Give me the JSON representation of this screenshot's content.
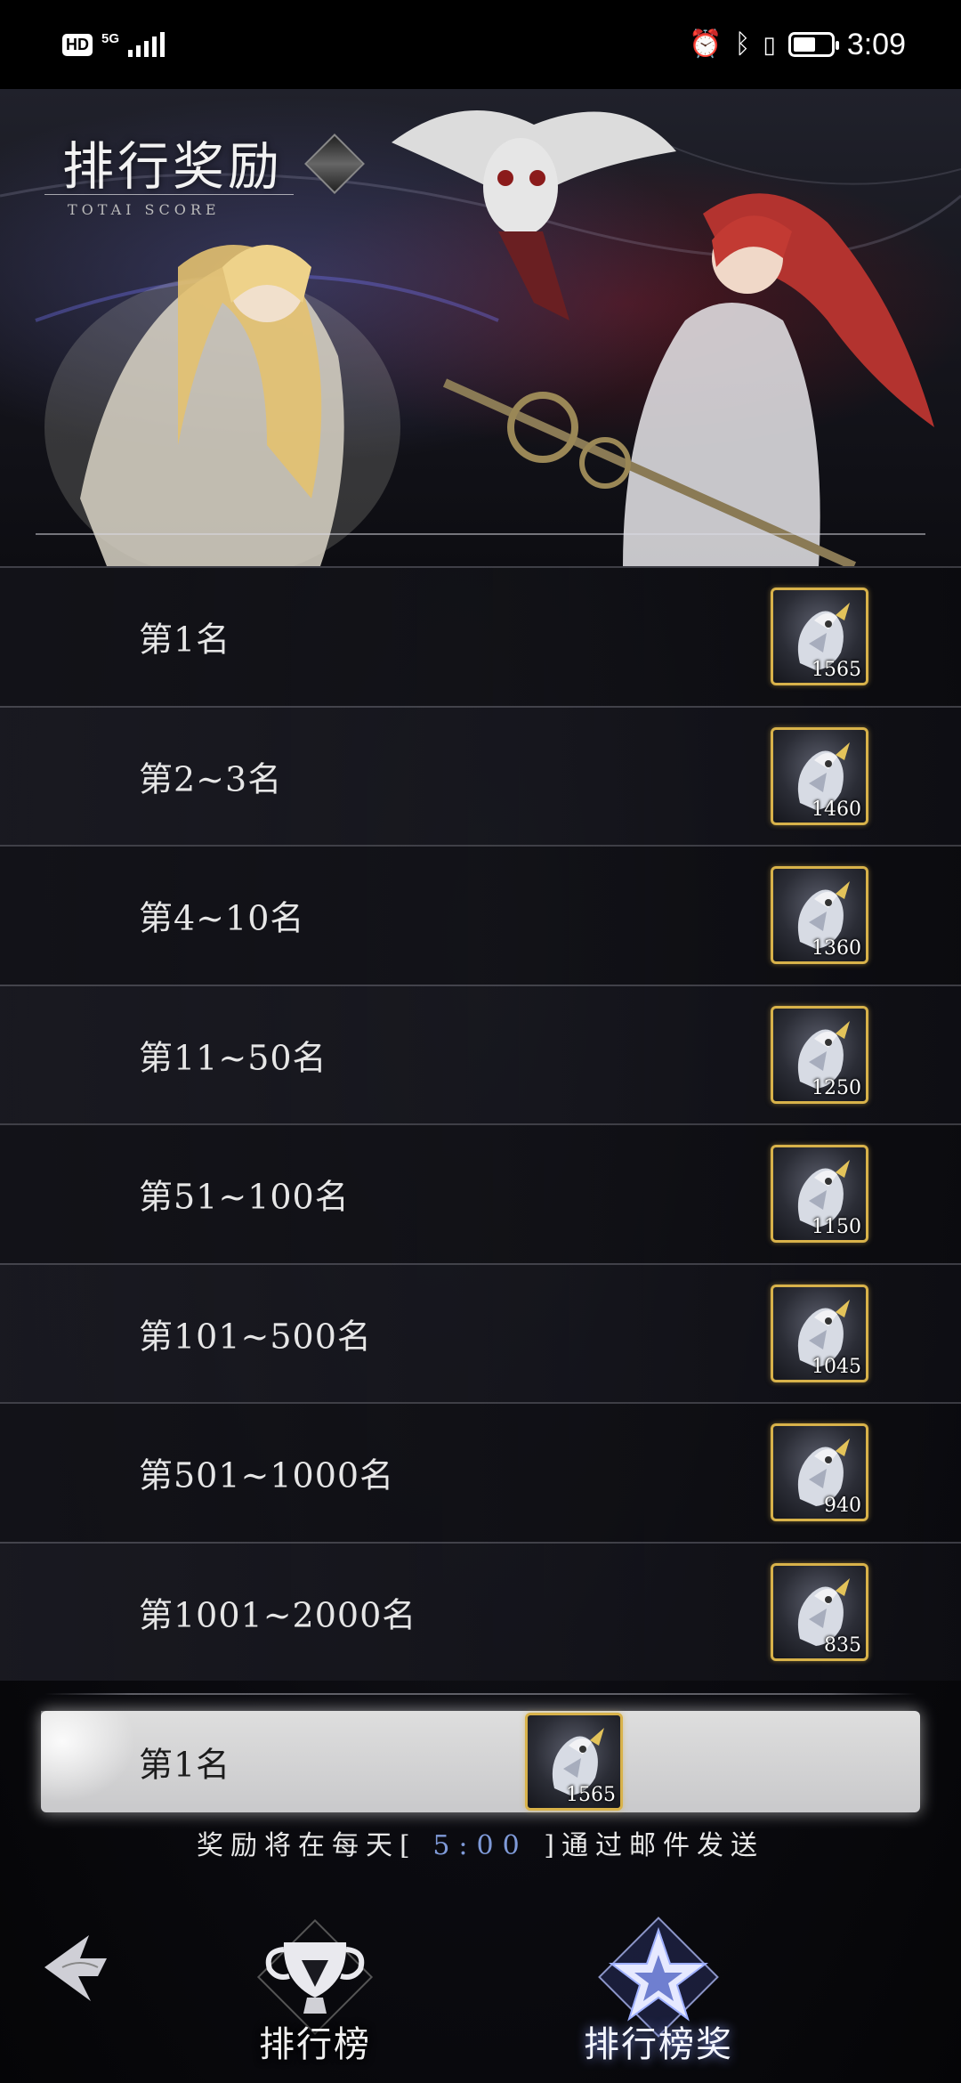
{
  "status_bar": {
    "hd": "HD",
    "network": "5G",
    "time": "3:09",
    "battery_level": 0.6,
    "icons": [
      "alarm-icon",
      "bluetooth-icon",
      "vibrate-icon",
      "battery-icon"
    ]
  },
  "header": {
    "title": "排行奖励",
    "subtitle": "TOTAI SCORE"
  },
  "ranks": [
    {
      "label": "第1名",
      "reward_count": "1565"
    },
    {
      "label": "第2~3名",
      "reward_count": "1460"
    },
    {
      "label": "第4~10名",
      "reward_count": "1360"
    },
    {
      "label": "第11~50名",
      "reward_count": "1250"
    },
    {
      "label": "第51~100名",
      "reward_count": "1150"
    },
    {
      "label": "第101~500名",
      "reward_count": "1045"
    },
    {
      "label": "第501~1000名",
      "reward_count": "940"
    },
    {
      "label": "第1001~2000名",
      "reward_count": "835"
    }
  ],
  "my_rank": {
    "label": "第1名",
    "reward_count": "1565"
  },
  "notice": {
    "prefix": "奖励将在每天[",
    "time": "5:00",
    "suffix": "]通过邮件发送"
  },
  "nav": {
    "leaderboard_label": "排行榜",
    "rewards_label": "排行榜奖"
  },
  "colors": {
    "reward_border": "#d8b24a",
    "notice_time": "#7f9ad8",
    "active_tab_glow": "#8ca0ff"
  }
}
